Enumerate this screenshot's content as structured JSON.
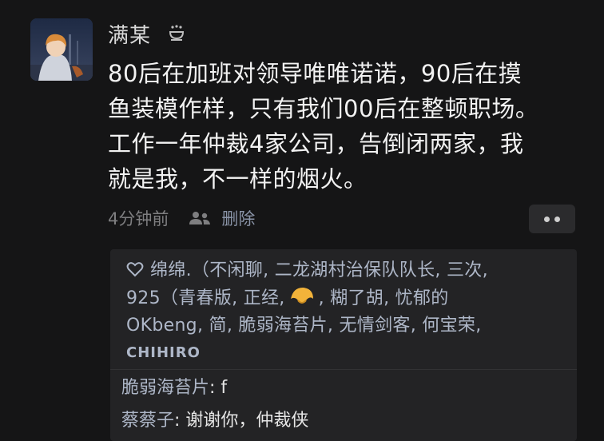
{
  "user": {
    "name": "满某",
    "avatar_icon": "anime-avatar",
    "badge_icon": "cup-badge-icon"
  },
  "post": {
    "lines": [
      "80后在加班对领导唯唯诺诺，90后在摸",
      "鱼装模作样，只有我们00后在整顿职场。",
      "工作一年仲裁4家公司，告倒闭两家，我",
      "就是我，不一样的烟火。"
    ]
  },
  "meta": {
    "time": "4分钟前",
    "delete_label": "删除",
    "visibility_icon": "friends-icon",
    "more_icon": "more-dots-icon"
  },
  "likes": {
    "line1": "绵绵.（不闲聊, 二龙湖村治保队队长, 三次,",
    "line2_a": "925（青春版, 正经,",
    "line2_b": ", 糊了胡, 忧郁的",
    "line3": "OKbeng, 简, 脆弱海苔片, 无情剑客, 何宝荣,",
    "line4": "CHIHIRO"
  },
  "comments": [
    {
      "who": "脆弱海苔片",
      "sep": ":",
      "text": " f"
    },
    {
      "who": "蔡蔡子",
      "sep": ":",
      "text": " 谢谢你，仲裁侠"
    }
  ],
  "colors": {
    "background": "#151516",
    "link": "#aeb7c8",
    "meta": "#7e7e80",
    "panel": "#232325"
  }
}
